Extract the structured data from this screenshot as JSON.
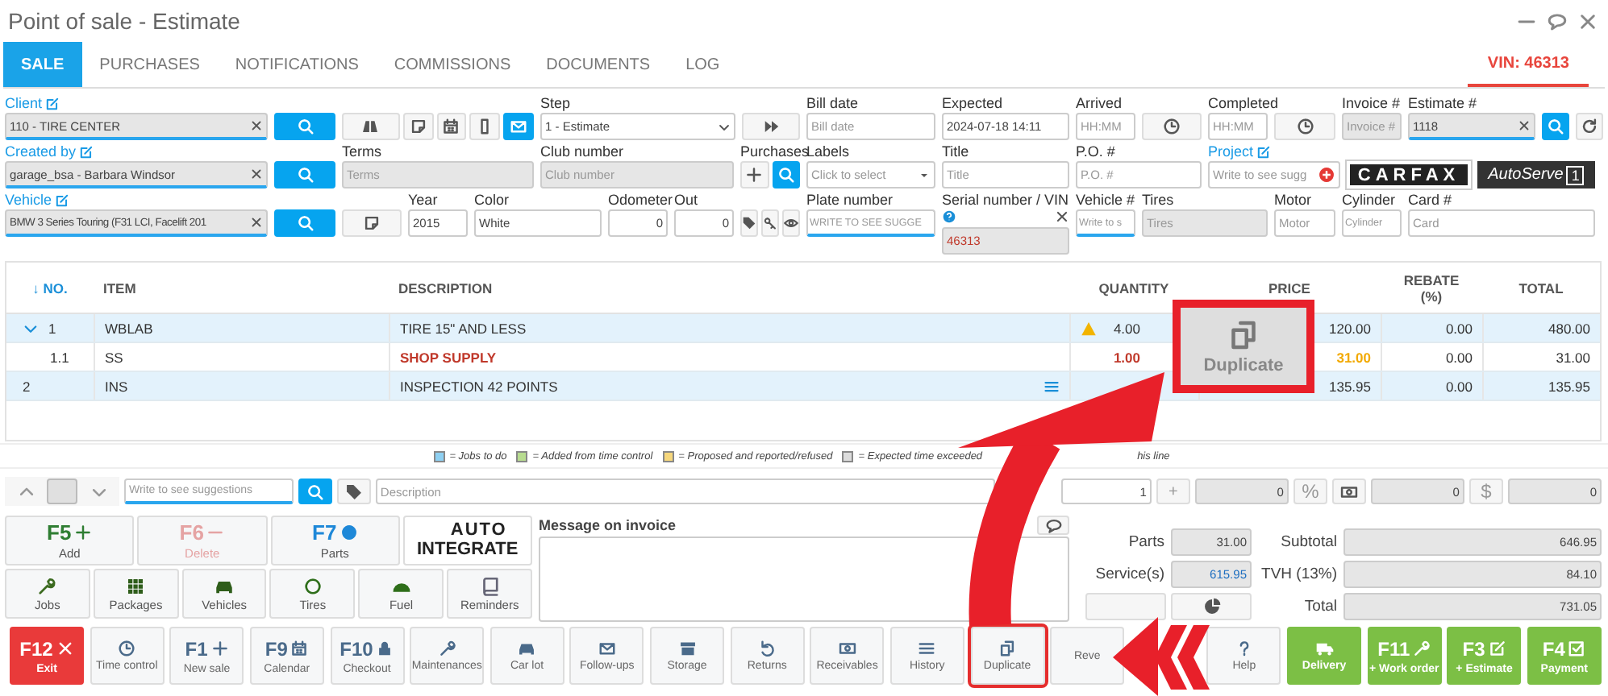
{
  "window": {
    "title": "Point of sale - Estimate"
  },
  "tabs": [
    {
      "label": "SALE",
      "selected": true
    },
    {
      "label": "PURCHASES",
      "selected": false
    },
    {
      "label": "NOTIFICATIONS",
      "selected": false
    },
    {
      "label": "COMMISSIONS",
      "selected": false
    },
    {
      "label": "DOCUMENTS",
      "selected": false
    },
    {
      "label": "LOG",
      "selected": false
    }
  ],
  "vin_tab": {
    "label": "VIN: 46313"
  },
  "form": {
    "client": {
      "label": "Client",
      "value": "110 - TIRE CENTER"
    },
    "step": {
      "label": "Step",
      "value": "1 - Estimate"
    },
    "bill_date": {
      "label": "Bill date",
      "placeholder": "Bill date"
    },
    "expected": {
      "label": "Expected",
      "value": "2024-07-18 14:11"
    },
    "arrived": {
      "label": "Arrived",
      "placeholder": "HH:MM"
    },
    "completed": {
      "label": "Completed",
      "placeholder": "HH:MM"
    },
    "invoice": {
      "label": "Invoice #",
      "placeholder": "Invoice #"
    },
    "estimate": {
      "label": "Estimate #",
      "value": "1118"
    },
    "created_by": {
      "label": "Created by",
      "value": "garage_bsa - Barbara Windsor"
    },
    "terms": {
      "label": "Terms",
      "placeholder": "Terms"
    },
    "club_number": {
      "label": "Club number",
      "placeholder": "Club number"
    },
    "purchases": {
      "label": "Purchases"
    },
    "labels": {
      "label": "Labels",
      "placeholder": "Click to select"
    },
    "title": {
      "label": "Title",
      "placeholder": "Title"
    },
    "po": {
      "label": "P.O. #",
      "placeholder": "P.O. #"
    },
    "project": {
      "label": "Project",
      "placeholder": "Write to see sugg"
    },
    "carfax": "CARFAX",
    "autoserve": {
      "name": "AutoServe",
      "mark": "1"
    },
    "vehicle": {
      "label": "Vehicle",
      "value": "BMW 3 Series Touring (F31 LCI, Facelift 201"
    },
    "year": {
      "label": "Year",
      "value": "2015"
    },
    "color": {
      "label": "Color",
      "value": "White"
    },
    "odometer": {
      "label": "Odometer",
      "value": "0"
    },
    "out": {
      "label": "Out",
      "value": "0"
    },
    "plate": {
      "label": "Plate number",
      "placeholder": "WRITE TO SEE SUGGE"
    },
    "serial": {
      "label": "Serial number / VIN",
      "value": "46313"
    },
    "vehicle_no": {
      "label": "Vehicle #",
      "placeholder": "Write to s"
    },
    "tires": {
      "label": "Tires",
      "placeholder": "Tires"
    },
    "motor": {
      "label": "Motor",
      "placeholder": "Motor"
    },
    "cylinder": {
      "label": "Cylinder",
      "placeholder": "Cylinder"
    },
    "card": {
      "label": "Card #",
      "placeholder": "Card"
    }
  },
  "table": {
    "columns": [
      "↓ NO.",
      "ITEM",
      "DESCRIPTION",
      "QUANTITY",
      "PRICE",
      "REBATE (%)",
      "TOTAL"
    ],
    "rows": [
      {
        "no": "1",
        "item": "WBLAB",
        "description": "TIRE 15\" AND LESS",
        "kind": "item",
        "warning": true,
        "note": false,
        "quantity": "4.00",
        "price": "120.00",
        "rebate": "0.00",
        "total": "480.00",
        "color": "#e3f2fc",
        "expanded": true,
        "children": [
          {
            "no": "1.1",
            "item": "SS",
            "description": "SHOP SUPPLY",
            "kind": "fee",
            "warning": false,
            "note": false,
            "quantity": "1.00",
            "price": "31.00",
            "rebate": "0.00",
            "total": "31.00",
            "color": "#ffffff"
          }
        ]
      },
      {
        "no": "2",
        "item": "INS",
        "description": "INSPECTION 42 POINTS",
        "kind": "item",
        "warning": false,
        "note": true,
        "price": "135.95",
        "rebate": "0.00",
        "total": "135.95",
        "color": "#e3f2fc"
      }
    ]
  },
  "callout": {
    "label": "Duplicate"
  },
  "legend": [
    {
      "label": "= Jobs to do",
      "color": "#8ed0f2"
    },
    {
      "label": "= Added from time control",
      "color": "#b8dc90"
    },
    {
      "label": "= Proposed and reported/refused",
      "color": "#f6d77c"
    },
    {
      "label": "= Expected time exceeded",
      "color": "#dcdcdc"
    }
  ],
  "legend_tail": "his line",
  "entry": {
    "suggest_placeholder": "Write to see suggestions",
    "description_placeholder": "Description",
    "quantity": "1",
    "plus": "+",
    "rebate": "0",
    "percent": "%",
    "amount": "0",
    "dollar": "$",
    "total": "0"
  },
  "quick_actions": [
    {
      "key": "F5",
      "label": "Add",
      "disabled": false
    },
    {
      "key": "F6",
      "label": "Delete",
      "disabled": true
    },
    {
      "key": "F7",
      "label": "Parts",
      "disabled": false
    }
  ],
  "partner_logo": {
    "line1": "AUTO",
    "line2": "INTEGRATE"
  },
  "categories": [
    {
      "label": "Jobs"
    },
    {
      "label": "Packages"
    },
    {
      "label": "Vehicles"
    },
    {
      "label": "Tires"
    },
    {
      "label": "Fuel"
    },
    {
      "label": "Reminders"
    }
  ],
  "message": {
    "label": "Message on invoice"
  },
  "totals": {
    "parts": {
      "label": "Parts",
      "value": "31.00"
    },
    "services": {
      "label": "Service(s)",
      "value": "615.95"
    },
    "subtotal": {
      "label": "Subtotal",
      "value": "646.95"
    },
    "tax": {
      "label": "TVH (13%)",
      "value": "84.10"
    },
    "total": {
      "label": "Total",
      "value": "731.05"
    }
  },
  "toolbar": [
    {
      "key": "F12",
      "label": "Exit",
      "kind": "exit",
      "highlighted": false
    },
    {
      "label": "Time control",
      "kind": "plain",
      "highlighted": false
    },
    {
      "key": "F1",
      "label": "New sale",
      "kind": "plain",
      "highlighted": false
    },
    {
      "key": "F9",
      "label": "Calendar",
      "kind": "plain",
      "highlighted": false
    },
    {
      "key": "F10",
      "label": "Checkout",
      "kind": "plain",
      "highlighted": false
    },
    {
      "label": "Maintenances",
      "kind": "plain",
      "highlighted": false
    },
    {
      "label": "Car lot",
      "kind": "plain",
      "highlighted": false
    },
    {
      "label": "Follow-ups",
      "kind": "plain",
      "highlighted": false
    },
    {
      "label": "Storage",
      "kind": "plain",
      "highlighted": false
    },
    {
      "label": "Returns",
      "kind": "plain",
      "highlighted": false
    },
    {
      "label": "Receivables",
      "kind": "plain",
      "highlighted": false
    },
    {
      "label": "History",
      "kind": "plain",
      "highlighted": false
    },
    {
      "label": "Duplicate",
      "kind": "plain",
      "highlighted": true
    },
    {
      "label": "Reve",
      "kind": "plain",
      "highlighted": false
    },
    {
      "label": "Help",
      "kind": "plain",
      "highlighted": false
    },
    {
      "label": "Delivery",
      "kind": "action",
      "highlighted": false
    },
    {
      "key": "F11",
      "label": "+ Work order",
      "kind": "action",
      "highlighted": false
    },
    {
      "key": "F3",
      "label": "+ Estimate",
      "kind": "action",
      "highlighted": false
    },
    {
      "key": "F4",
      "label": "Payment",
      "kind": "action",
      "highlighted": false
    }
  ]
}
